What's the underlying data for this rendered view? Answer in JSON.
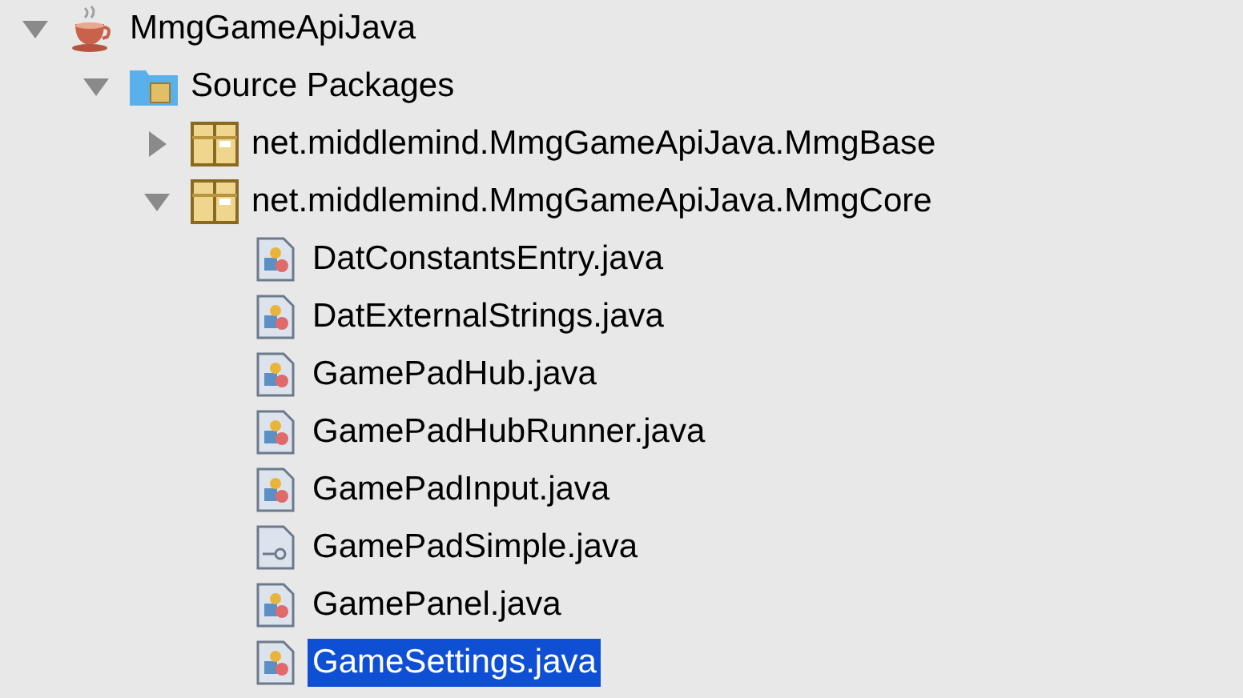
{
  "tree": [
    {
      "kind": "project",
      "label": "MmgGameApiJava",
      "expanded": true,
      "selected": false,
      "children": [
        {
          "kind": "source",
          "label": "Source Packages",
          "expanded": true,
          "selected": false,
          "children": [
            {
              "kind": "package",
              "label": "net.middlemind.MmgGameApiJava.MmgBase",
              "expanded": false,
              "selected": false
            },
            {
              "kind": "package",
              "label": "net.middlemind.MmgGameApiJava.MmgCore",
              "expanded": true,
              "selected": false,
              "children": [
                {
                  "kind": "class",
                  "label": "DatConstantsEntry.java",
                  "selected": false
                },
                {
                  "kind": "class",
                  "label": "DatExternalStrings.java",
                  "selected": false
                },
                {
                  "kind": "class",
                  "label": "GamePadHub.java",
                  "selected": false
                },
                {
                  "kind": "class",
                  "label": "GamePadHubRunner.java",
                  "selected": false
                },
                {
                  "kind": "class",
                  "label": "GamePadInput.java",
                  "selected": false
                },
                {
                  "kind": "interface",
                  "label": "GamePadSimple.java",
                  "selected": false
                },
                {
                  "kind": "class",
                  "label": "GamePanel.java",
                  "selected": false
                },
                {
                  "kind": "class",
                  "label": "GameSettings.java",
                  "selected": true
                }
              ]
            }
          ]
        }
      ]
    }
  ]
}
